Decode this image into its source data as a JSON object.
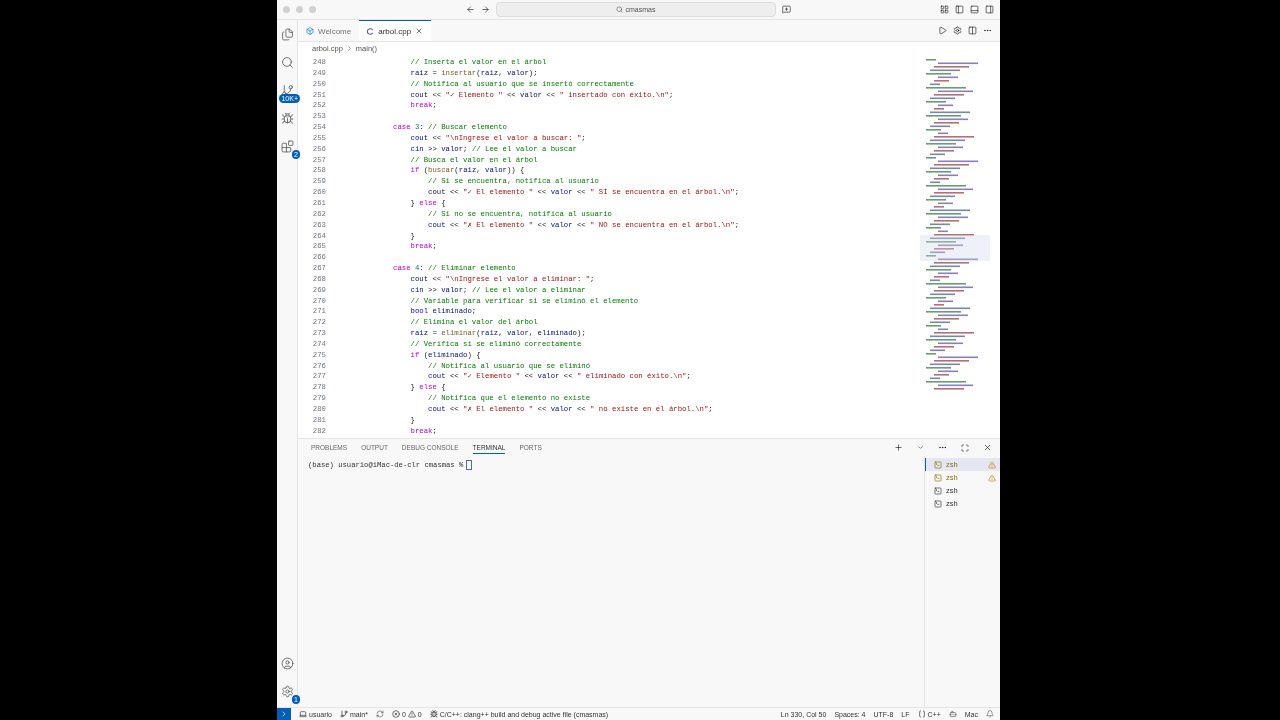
{
  "title_bar": {
    "search": "cmasmas"
  },
  "activity_bar": {
    "source_control_badge": "10K+",
    "extensions_badge": "2",
    "settings_badge": "1"
  },
  "editor_tabs": [
    {
      "label": "Welcome",
      "selected": false,
      "kind": "welcome"
    },
    {
      "label": "arbol.cpp",
      "selected": true,
      "kind": "cpp"
    }
  ],
  "breadcrumb": [
    "arbol.cpp",
    "main()"
  ],
  "code_lines": [
    {
      "number": "248",
      "tokens": [
        {
          "kind": "c",
          "text": "            // Inserta el valor en el árbol"
        }
      ]
    },
    {
      "number": "249",
      "tokens": [
        {
          "kind": "p",
          "text": "            raiz"
        },
        {
          "kind": "o",
          "text": " = "
        },
        {
          "kind": "f",
          "text": "insertar"
        },
        {
          "kind": "o",
          "text": "("
        },
        {
          "kind": "p",
          "text": "raiz"
        },
        {
          "kind": "o",
          "text": ", "
        },
        {
          "kind": "p",
          "text": "valor"
        },
        {
          "kind": "o",
          "text": ");"
        }
      ]
    },
    {
      "number": "250",
      "tokens": [
        {
          "kind": "c",
          "text": "            // Notifica al usuario que se insertó correctamente"
        }
      ]
    },
    {
      "number": "251",
      "tokens": [
        {
          "kind": "p",
          "text": "            cout"
        },
        {
          "kind": "o",
          "text": " << "
        },
        {
          "kind": "s",
          "text": "\"✓ Elemento \""
        },
        {
          "kind": "o",
          "text": " << "
        },
        {
          "kind": "p",
          "text": "valor"
        },
        {
          "kind": "o",
          "text": " << "
        },
        {
          "kind": "s",
          "text": "\" insertado con éxito.\\n\""
        },
        {
          "kind": "o",
          "text": ";"
        }
      ]
    },
    {
      "number": "252",
      "tokens": [
        {
          "kind": "k",
          "text": "            break"
        },
        {
          "kind": "o",
          "text": ";"
        }
      ]
    },
    {
      "number": "253"
    },
    {
      "number": "254",
      "tokens": [
        {
          "kind": "k",
          "text": "        case"
        },
        {
          "kind": "n",
          "text": " 3"
        },
        {
          "kind": "o",
          "text": ": "
        },
        {
          "kind": "c",
          "text": "// Buscar elemento"
        }
      ]
    },
    {
      "number": "255",
      "tokens": [
        {
          "kind": "p",
          "text": "            cout"
        },
        {
          "kind": "o",
          "text": " << "
        },
        {
          "kind": "s",
          "text": "\"\\nIngrese el valor a buscar: \""
        },
        {
          "kind": "o",
          "text": ";"
        }
      ]
    },
    {
      "number": "256",
      "tokens": [
        {
          "kind": "p",
          "text": "            cin"
        },
        {
          "kind": "o",
          "text": " >> "
        },
        {
          "kind": "p",
          "text": "valor"
        },
        {
          "kind": "o",
          "text": "; "
        },
        {
          "kind": "c",
          "text": "// Lee el valor a buscar"
        }
      ]
    },
    {
      "number": "257",
      "tokens": [
        {
          "kind": "c",
          "text": "            // Busca el valor en el árbol"
        }
      ]
    },
    {
      "number": "258",
      "tokens": [
        {
          "kind": "k",
          "text": "            if"
        },
        {
          "kind": "o",
          "text": " ("
        },
        {
          "kind": "f",
          "text": "buscar"
        },
        {
          "kind": "o",
          "text": "("
        },
        {
          "kind": "p",
          "text": "raiz"
        },
        {
          "kind": "o",
          "text": ", "
        },
        {
          "kind": "p",
          "text": "valor"
        },
        {
          "kind": "o",
          "text": ")) {"
        }
      ]
    },
    {
      "number": "259",
      "tokens": [
        {
          "kind": "c",
          "text": "                // Si se encuentra, notifica al usuario"
        }
      ]
    },
    {
      "number": "260",
      "tokens": [
        {
          "kind": "p",
          "text": "                cout"
        },
        {
          "kind": "o",
          "text": " << "
        },
        {
          "kind": "s",
          "text": "\"✓ El elemento \""
        },
        {
          "kind": "o",
          "text": " << "
        },
        {
          "kind": "p",
          "text": "valor"
        },
        {
          "kind": "o",
          "text": " << "
        },
        {
          "kind": "s",
          "text": "\" SÍ se encuentra en el árbol.\\n\""
        },
        {
          "kind": "o",
          "text": ";"
        }
      ]
    },
    {
      "number": "261",
      "tokens": [
        {
          "kind": "o",
          "text": "            } "
        },
        {
          "kind": "k",
          "text": "else"
        },
        {
          "kind": "o",
          "text": " {"
        }
      ]
    },
    {
      "number": "262",
      "tokens": [
        {
          "kind": "c",
          "text": "                // Si no se encuentra, notifica al usuario"
        }
      ]
    },
    {
      "number": "263",
      "tokens": [
        {
          "kind": "p",
          "text": "                cout"
        },
        {
          "kind": "o",
          "text": " << "
        },
        {
          "kind": "s",
          "text": "\"✗ El elemento \""
        },
        {
          "kind": "o",
          "text": " << "
        },
        {
          "kind": "p",
          "text": "valor"
        },
        {
          "kind": "o",
          "text": " << "
        },
        {
          "kind": "s",
          "text": "\" NO se encuentra en el árbol.\\n\""
        },
        {
          "kind": "o",
          "text": ";"
        }
      ]
    },
    {
      "number": "264",
      "tokens": [
        {
          "kind": "o",
          "text": "            }"
        }
      ]
    },
    {
      "number": "265",
      "tokens": [
        {
          "kind": "k",
          "text": "            break"
        },
        {
          "kind": "o",
          "text": ";"
        }
      ]
    },
    {
      "number": "266"
    },
    {
      "number": "267",
      "tokens": [
        {
          "kind": "k",
          "text": "        case"
        },
        {
          "kind": "n",
          "text": " 4"
        },
        {
          "kind": "o",
          "text": ": "
        },
        {
          "kind": "c",
          "text": "// Eliminar elemento"
        }
      ]
    },
    {
      "number": "268",
      "tokens": [
        {
          "kind": "p",
          "text": "            cout"
        },
        {
          "kind": "o",
          "text": " << "
        },
        {
          "kind": "s",
          "text": "\"\\nIngrese el valor a eliminar: \""
        },
        {
          "kind": "o",
          "text": ";"
        }
      ]
    },
    {
      "number": "269",
      "tokens": [
        {
          "kind": "p",
          "text": "            cin"
        },
        {
          "kind": "o",
          "text": " >> "
        },
        {
          "kind": "p",
          "text": "valor"
        },
        {
          "kind": "o",
          "text": "; "
        },
        {
          "kind": "c",
          "text": "// Lee el valor a eliminar"
        }
      ]
    },
    {
      "number": "270",
      "tokens": [
        {
          "kind": "c",
          "text": "            // Variable para verificar si se eliminó el elemento"
        }
      ]
    },
    {
      "number": "271",
      "tokens": [
        {
          "kind": "t",
          "text": "            bool"
        },
        {
          "kind": "p",
          "text": " eliminado"
        },
        {
          "kind": "o",
          "text": ";"
        }
      ]
    },
    {
      "number": "272",
      "tokens": [
        {
          "kind": "c",
          "text": "            // Elimina el valor del árbol"
        }
      ]
    },
    {
      "number": "273",
      "tokens": [
        {
          "kind": "p",
          "text": "            raiz"
        },
        {
          "kind": "o",
          "text": " = "
        },
        {
          "kind": "f",
          "text": "eliminar"
        },
        {
          "kind": "o",
          "text": "("
        },
        {
          "kind": "p",
          "text": "raiz"
        },
        {
          "kind": "o",
          "text": ", "
        },
        {
          "kind": "p",
          "text": "valor"
        },
        {
          "kind": "o",
          "text": ", "
        },
        {
          "kind": "p",
          "text": "eliminado"
        },
        {
          "kind": "o",
          "text": ");"
        }
      ]
    },
    {
      "number": "274",
      "tokens": [
        {
          "kind": "c",
          "text": "            // Verifica si se eliminó correctamente"
        }
      ]
    },
    {
      "number": "275",
      "tokens": [
        {
          "kind": "k",
          "text": "            if"
        },
        {
          "kind": "o",
          "text": " ("
        },
        {
          "kind": "p",
          "text": "eliminado"
        },
        {
          "kind": "o",
          "text": ") {"
        }
      ]
    },
    {
      "number": "276",
      "tokens": [
        {
          "kind": "c",
          "text": "                // Notifica al usuario que se eliminó"
        }
      ]
    },
    {
      "number": "277",
      "tokens": [
        {
          "kind": "p",
          "text": "                cout"
        },
        {
          "kind": "o",
          "text": " << "
        },
        {
          "kind": "s",
          "text": "\"✓ Elemento \""
        },
        {
          "kind": "o",
          "text": " << "
        },
        {
          "kind": "p",
          "text": "valor"
        },
        {
          "kind": "o",
          "text": " << "
        },
        {
          "kind": "s",
          "text": "\" eliminado con éxito.\\n\""
        },
        {
          "kind": "o",
          "text": ";"
        }
      ]
    },
    {
      "number": "278",
      "tokens": [
        {
          "kind": "o",
          "text": "            } "
        },
        {
          "kind": "k",
          "text": "else"
        },
        {
          "kind": "o",
          "text": " {"
        }
      ]
    },
    {
      "number": "279",
      "tokens": [
        {
          "kind": "c",
          "text": "                // Notifica que el elemento no existe"
        }
      ]
    },
    {
      "number": "280",
      "tokens": [
        {
          "kind": "p",
          "text": "                cout"
        },
        {
          "kind": "o",
          "text": " << "
        },
        {
          "kind": "s",
          "text": "\"✗ El elemento \""
        },
        {
          "kind": "o",
          "text": " << "
        },
        {
          "kind": "p",
          "text": "valor"
        },
        {
          "kind": "o",
          "text": " << "
        },
        {
          "kind": "s",
          "text": "\" no existe en el árbol.\\n\""
        },
        {
          "kind": "o",
          "text": ";"
        }
      ]
    },
    {
      "number": "281",
      "tokens": [
        {
          "kind": "o",
          "text": "            }"
        }
      ]
    },
    {
      "number": "282",
      "tokens": [
        {
          "kind": "k",
          "text": "            break"
        },
        {
          "kind": "o",
          "text": ";"
        }
      ]
    }
  ],
  "panel_tabs": [
    {
      "label": "PROBLEMS",
      "selected": false
    },
    {
      "label": "OUTPUT",
      "selected": false
    },
    {
      "label": "DEBUG CONSOLE",
      "selected": false
    },
    {
      "label": "TERMINAL",
      "selected": true
    },
    {
      "label": "PORTS",
      "selected": false
    }
  ],
  "terminal": {
    "prompt": "(base) usuario@iMac-de-clr cmasmas %"
  },
  "terminals": [
    {
      "label": "zsh",
      "selected": true,
      "warning": true
    },
    {
      "label": "zsh",
      "selected": false,
      "warning": true
    },
    {
      "label": "zsh",
      "selected": false,
      "warning": false
    },
    {
      "label": "zsh",
      "selected": false,
      "warning": false
    }
  ],
  "status_bar": {
    "user": "usuario",
    "branch": "main*",
    "errors": "0",
    "warnings": "0",
    "task": "C/C++: clang++ build and debug active file (cmasmas)",
    "position": "Ln 330, Col 50",
    "spaces": "Spaces: 4",
    "encoding": "UTF-8",
    "eol": "LF",
    "language": "C++",
    "layout": "Mac"
  }
}
